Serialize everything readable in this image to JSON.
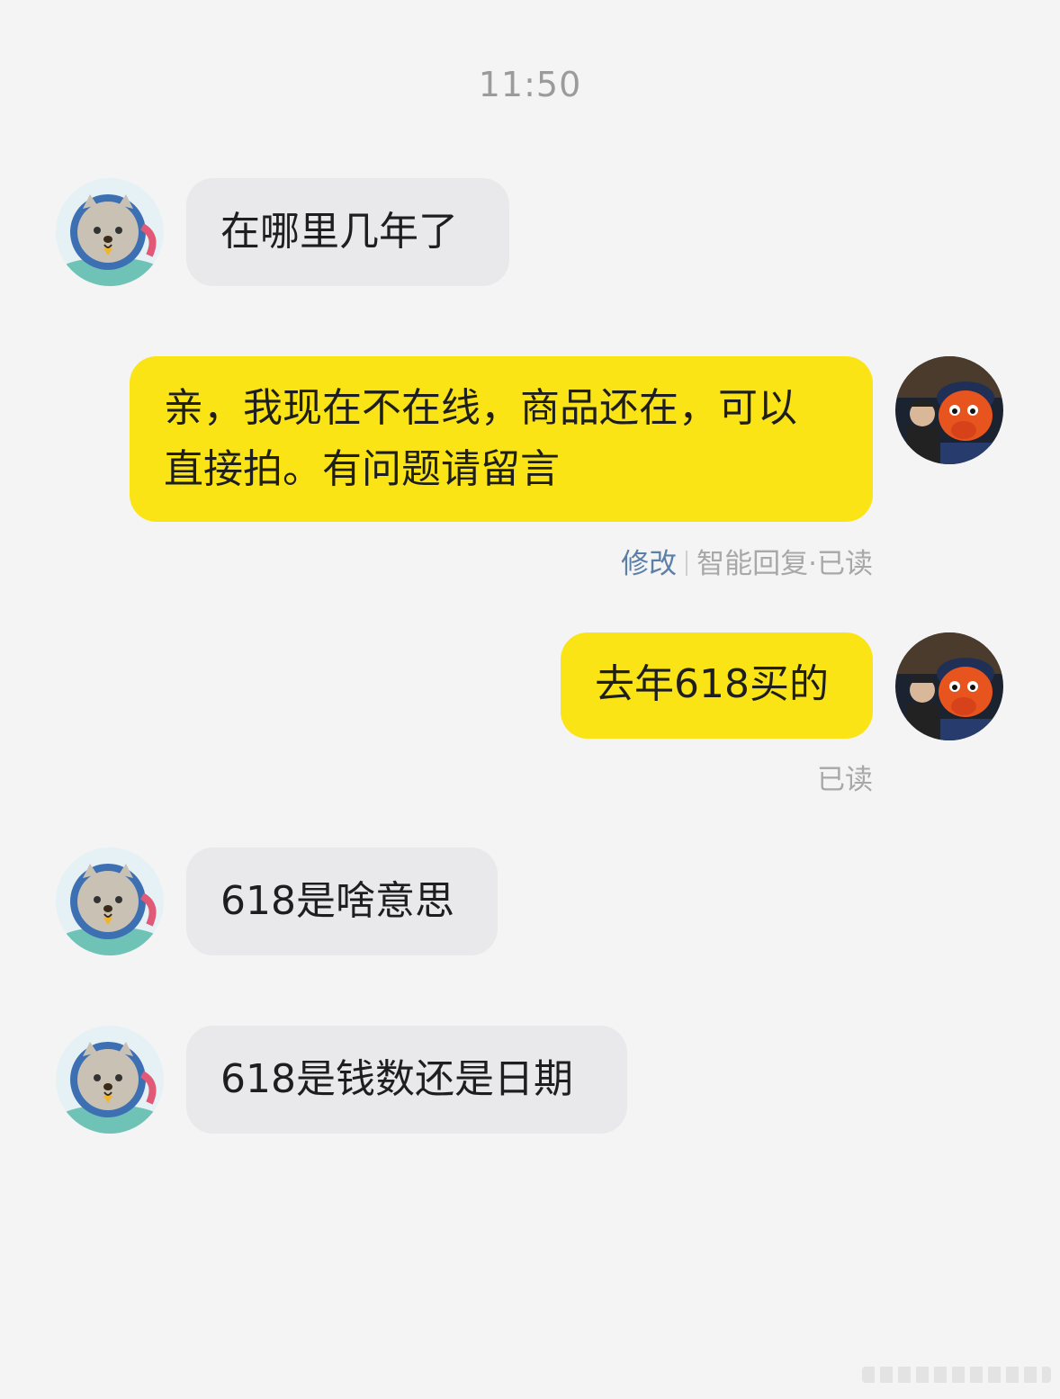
{
  "timestamp": "11:50",
  "messages": [
    {
      "side": "in",
      "text": "在哪里几年了",
      "avatar": "cat-astronaut-avatar"
    },
    {
      "side": "out",
      "text": "亲，我现在不在线，商品还在，可以直接拍。有问题请留言",
      "avatar": "mascot-photo-avatar",
      "meta": {
        "edit_label": "修改",
        "status_label": "智能回复·已读"
      }
    },
    {
      "side": "out",
      "text": "去年618买的",
      "avatar": "mascot-photo-avatar",
      "meta": {
        "status_label": "已读"
      }
    },
    {
      "side": "in",
      "text": "618是啥意思",
      "avatar": "cat-astronaut-avatar"
    },
    {
      "side": "in",
      "text": "618是钱数还是日期",
      "avatar": "cat-astronaut-avatar"
    }
  ],
  "colors": {
    "background": "#f4f4f4",
    "incoming_bubble": "#e9e9eb",
    "outgoing_bubble": "#fbe415",
    "meta_text": "#a8a8a8",
    "edit_link": "#5b7fa6"
  }
}
